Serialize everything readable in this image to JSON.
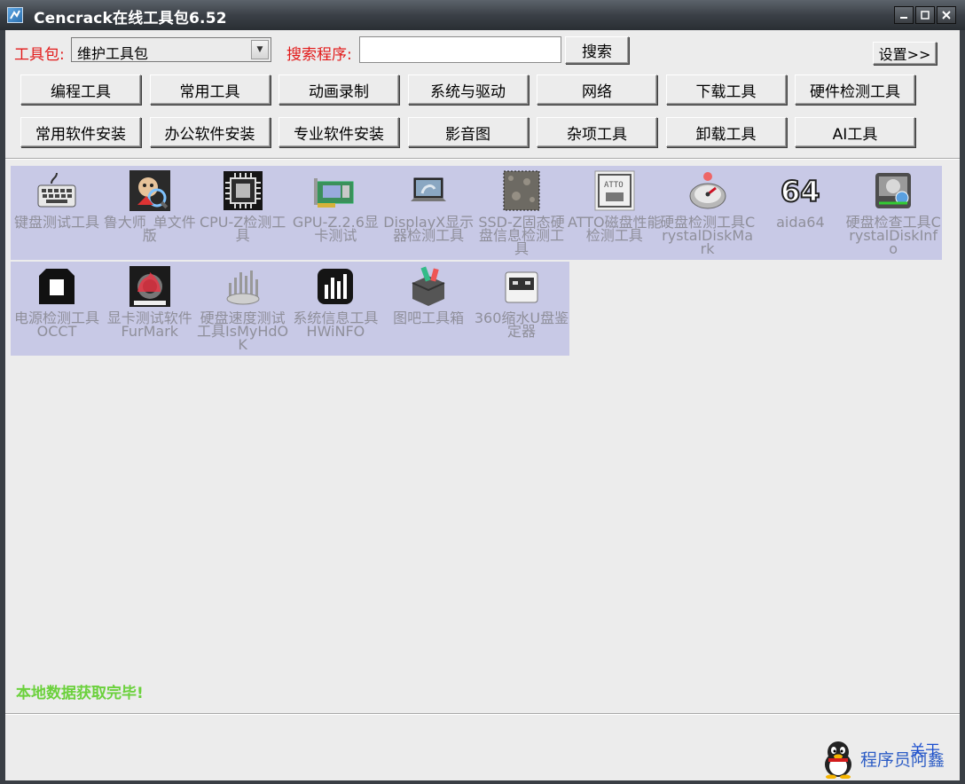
{
  "window": {
    "title": "Cencrack在线工具包6.52",
    "controls": [
      "minimize-icon",
      "maximize-icon",
      "close-icon"
    ]
  },
  "toolbar": {
    "package_label": "工具包:",
    "package_value": "维护工具包",
    "search_label": "搜索程序:",
    "search_value": "",
    "search_button": "搜索",
    "settings_button": "设置>>"
  },
  "categories": {
    "row1": [
      "编程工具",
      "常用工具",
      "动画录制",
      "系统与驱动",
      "网络",
      "下载工具",
      "硬件检测工具"
    ],
    "row2": [
      "常用软件安装",
      "办公软件安装",
      "专业软件安装",
      "影音图",
      "杂项工具",
      "卸载工具",
      "AI工具"
    ]
  },
  "tools": [
    {
      "label": "键盘测试工具",
      "icon": "keyboard-icon"
    },
    {
      "label": "鲁大师_单文件版",
      "icon": "ludashi-icon"
    },
    {
      "label": "CPU-Z检测工具",
      "icon": "cpu-chip-icon"
    },
    {
      "label": "GPU-Z.2.6显卡测试",
      "icon": "graphics-card-icon"
    },
    {
      "label": "DisplayX显示器检测工具",
      "icon": "laptop-icon"
    },
    {
      "label": "SSD-Z固态硬盘信息检测工具",
      "icon": "ssd-icon"
    },
    {
      "label": "ATTO磁盘性能检测工具",
      "icon": "atto-disk-icon"
    },
    {
      "label": "硬盘检测工具CrystalDiskMark",
      "icon": "disk-gauge-icon"
    },
    {
      "label": "aida64",
      "icon": "aida64-icon"
    },
    {
      "label": "硬盘检查工具CrystalDiskInfo",
      "icon": "disk-info-icon"
    },
    {
      "label": "电源检测工具OCCT",
      "icon": "occt-icon"
    },
    {
      "label": "显卡测试软件 FurMark",
      "icon": "furmark-icon"
    },
    {
      "label": "硬盘速度测试工具IsMyHdOK",
      "icon": "hdd-speed-icon"
    },
    {
      "label": "系统信息工具HWiNFO",
      "icon": "hwinfo-icon"
    },
    {
      "label": "图吧工具箱",
      "icon": "toolbox-icon"
    },
    {
      "label": "360缩水U盘鉴定器",
      "icon": "usb-drive-icon"
    }
  ],
  "status": {
    "message": "本地数据获取完毕!",
    "about_link": "关于",
    "brand": "程序员阿鑫"
  },
  "colors": {
    "label_red": "#e21a1a",
    "status_green": "#6bd13c",
    "grid_bg": "#c8c9e6",
    "link_blue": "#1c4fcf"
  }
}
